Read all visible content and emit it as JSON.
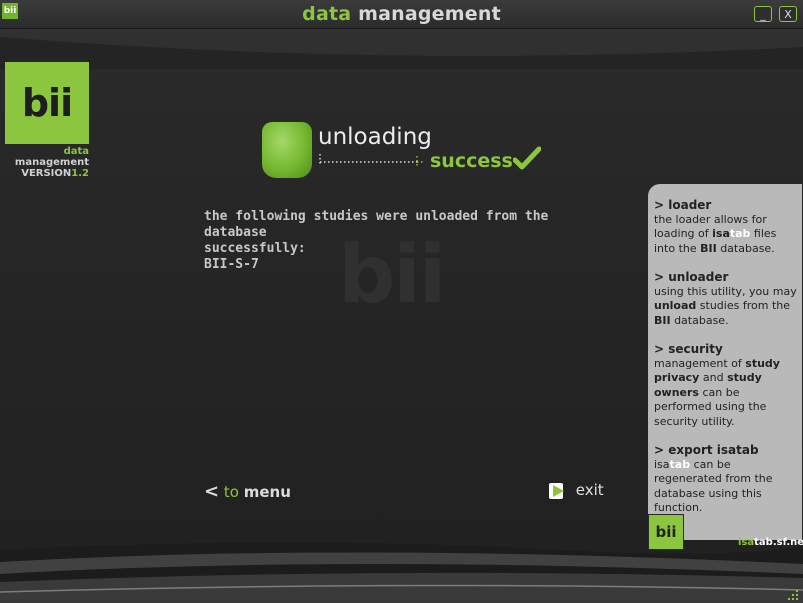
{
  "window": {
    "icon_text": "bii",
    "title_part1": "data",
    "title_part2": "management",
    "minimize_label": "_",
    "close_label": "X"
  },
  "logo": {
    "text": "bii",
    "subtitle_part1": "data",
    "subtitle_part2": "management",
    "version_label": "VERSION",
    "version_number": "1.2"
  },
  "watermark": "bii",
  "status": {
    "operation": "unloading",
    "result": "success",
    "icon": "green-drum-icon",
    "result_icon": "checkmark-icon"
  },
  "message": {
    "line1": "the following studies were unloaded from the database",
    "line2": "successfully:",
    "studies": [
      "BII-S-7"
    ]
  },
  "nav": {
    "to_menu_prefix": "to",
    "to_menu_label": "menu",
    "exit_label": "exit"
  },
  "side_panel": {
    "loader": {
      "title": "> loader",
      "text1": "the loader allows for loading of ",
      "isa": "isa",
      "tab": "tab",
      "text2": " files into the ",
      "bii": "BII",
      "text3": " database."
    },
    "unloader": {
      "title": "> unloader",
      "text1": "using this utility, you may ",
      "unload": "unload",
      "text2": " studies from the ",
      "bii": "BII",
      "text3": " database."
    },
    "security": {
      "title": "> security",
      "text1": "management of ",
      "study_privacy": "study privacy",
      "and": " and ",
      "study_owners": "study owners",
      "text2": " can be performed using the security utility."
    },
    "export": {
      "title": "> export isatab",
      "isa": "isa",
      "tab": "tab",
      "text": " can be regenerated from the database using this function."
    },
    "logo_text": "bii",
    "site_part1": "isa",
    "site_part2": "tab.sf.net"
  },
  "colors": {
    "accent": "#8cc63f",
    "background": "#262626",
    "panel": "#b9b9b9"
  }
}
